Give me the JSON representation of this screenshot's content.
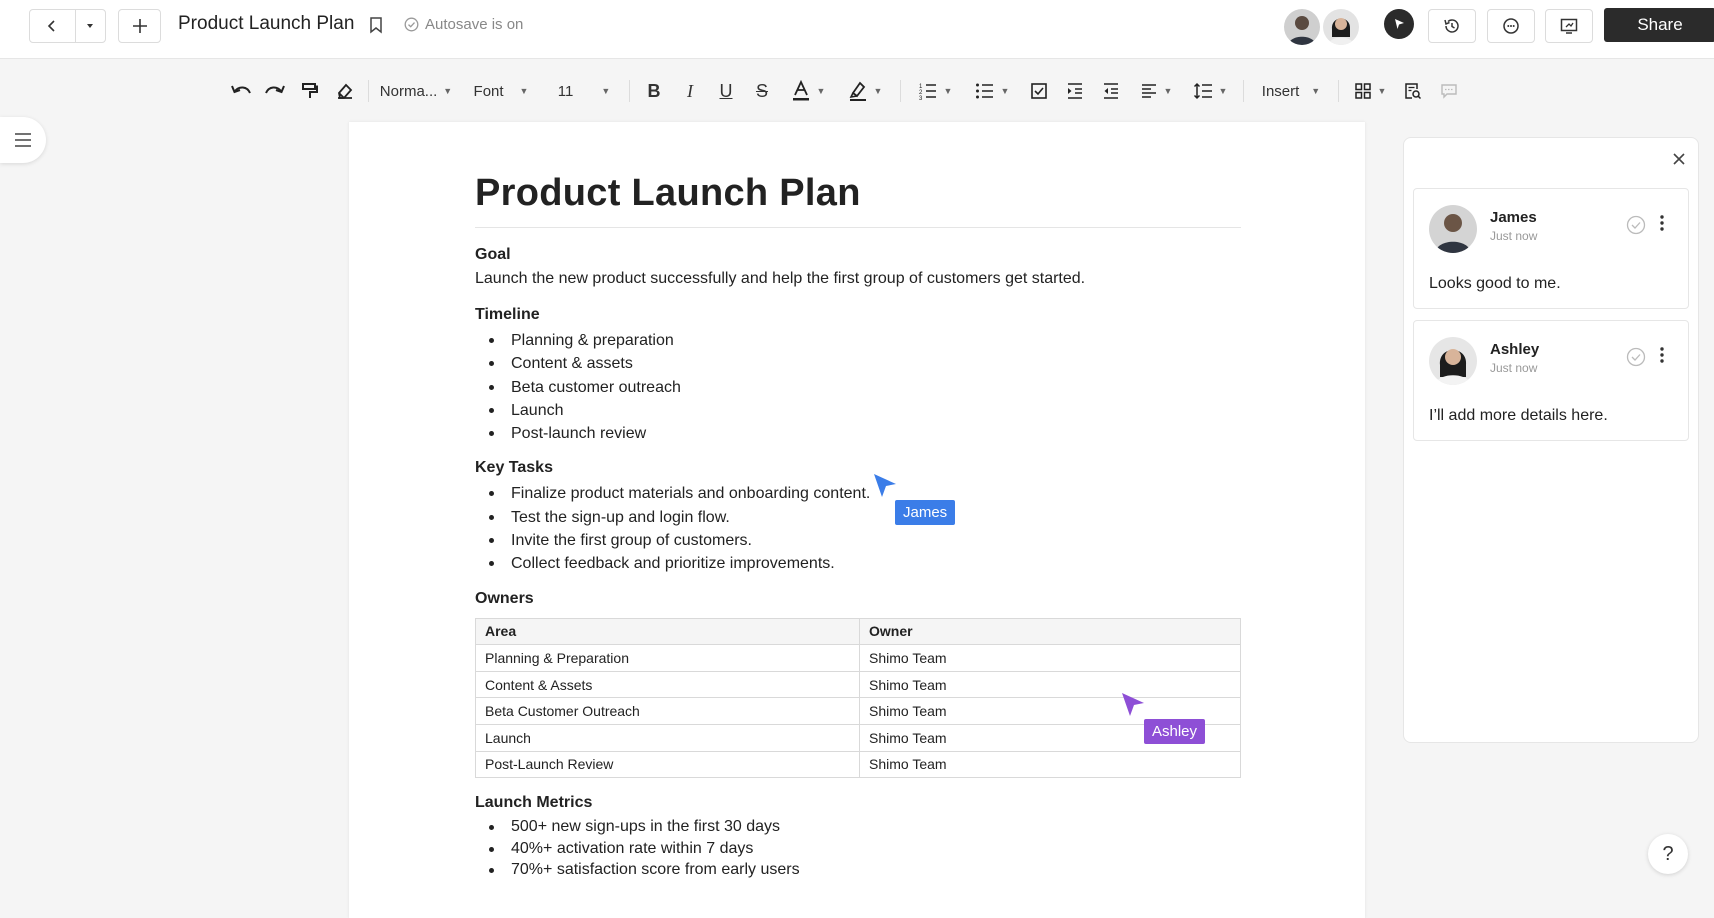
{
  "header": {
    "doc_title": "Product Launch Plan",
    "autosave": "Autosave is on",
    "share_label": "Share"
  },
  "toolbar": {
    "style_label": "Norma...",
    "font_label": "Font",
    "size_label": "11",
    "insert_label": "Insert"
  },
  "document": {
    "title": "Product Launch Plan",
    "goal_heading": "Goal",
    "goal_text": "Launch the new product successfully and help the first group of customers get started.",
    "timeline_heading": "Timeline",
    "timeline_items": [
      "Planning & preparation",
      "Content & assets",
      "Beta customer outreach",
      "Launch",
      "Post-launch review"
    ],
    "tasks_heading": "Key Tasks",
    "tasks_items": [
      "Finalize product materials and onboarding content.",
      "Test the sign-up and login flow.",
      "Invite the first group of customers.",
      "Collect feedback and prioritize improvements."
    ],
    "owners_heading": "Owners",
    "owners_table": {
      "headers": [
        "Area",
        "Owner"
      ],
      "rows": [
        [
          "Planning & Preparation",
          "Shimo Team"
        ],
        [
          "Content & Assets",
          "Shimo Team"
        ],
        [
          "Beta Customer Outreach",
          "Shimo Team"
        ],
        [
          "Launch",
          "Shimo Team"
        ],
        [
          "Post-Launch Review",
          "Shimo Team"
        ]
      ]
    },
    "metrics_heading": "Launch Metrics",
    "metrics_items": [
      "500+ new sign-ups in the first 30 days",
      "40%+ activation rate within 7 days",
      "70%+ satisfaction score from early users"
    ]
  },
  "cursors": {
    "james": {
      "name": "James",
      "color": "#3b7de8"
    },
    "ashley": {
      "name": "Ashley",
      "color": "#8e4fd6"
    }
  },
  "comments": [
    {
      "name": "James",
      "time": "Just now",
      "text": "Looks good to me."
    },
    {
      "name": "Ashley",
      "time": "Just now",
      "text": "I’ll add more details here."
    }
  ],
  "help_label": "?"
}
